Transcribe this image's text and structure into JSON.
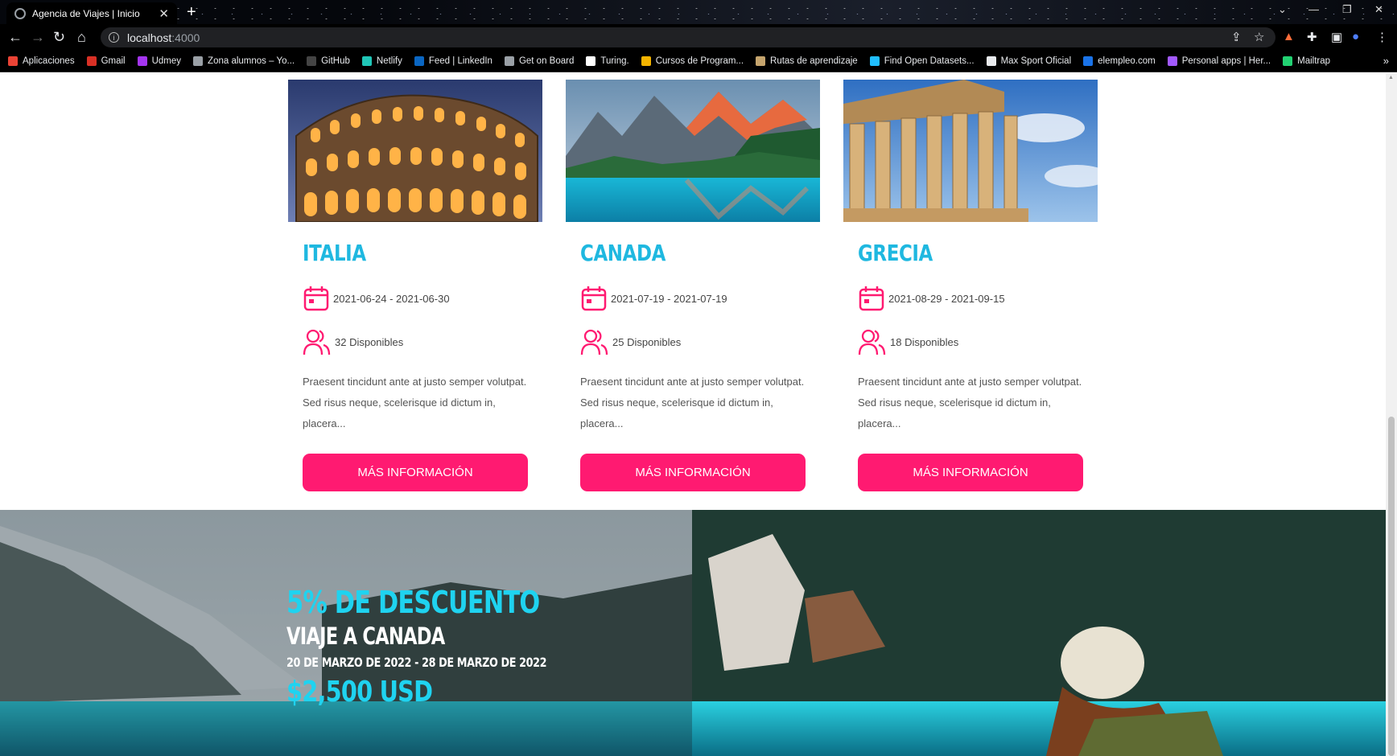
{
  "browser": {
    "tab_title": "Agencia de Viajes | Inicio",
    "url_host": "localhost",
    "url_port": ":4000",
    "bookmarks": [
      {
        "label": "Aplicaciones",
        "color": "#ea4335"
      },
      {
        "label": "Gmail",
        "color": "#d93025"
      },
      {
        "label": "Udmey",
        "color": "#a435f0"
      },
      {
        "label": "Zona alumnos – Yo...",
        "color": "#9aa0a6"
      },
      {
        "label": "GitHub",
        "color": "#444444"
      },
      {
        "label": "Netlify",
        "color": "#20c6b7"
      },
      {
        "label": "Feed | LinkedIn",
        "color": "#0a66c2"
      },
      {
        "label": "Get on Board",
        "color": "#9aa0a6"
      },
      {
        "label": "Turing.",
        "color": "#ffffff"
      },
      {
        "label": "Cursos de Program...",
        "color": "#f4b400"
      },
      {
        "label": "Rutas de aprendizaje",
        "color": "#c5a46d"
      },
      {
        "label": "Find Open Datasets...",
        "color": "#20beff"
      },
      {
        "label": "Max Sport Oficial",
        "color": "#e8eaed"
      },
      {
        "label": "elempleo.com",
        "color": "#1a73e8"
      },
      {
        "label": "Personal apps | Her...",
        "color": "#a259ff"
      },
      {
        "label": "Mailtrap",
        "color": "#22d172"
      }
    ]
  },
  "accent_color": "#ff1a71",
  "title_color": "#1fb8e0",
  "trips": [
    {
      "title": "ITALIA",
      "dates": "2021-06-24 - 2021-06-30",
      "available": "32 Disponibles",
      "description": "Praesent tincidunt ante at justo semper volutpat. Sed risus neque, scelerisque id dictum in, placera...",
      "button": "MÁS INFORMACIÓN",
      "image": "colosseum"
    },
    {
      "title": "CANADA",
      "dates": "2021-07-19 - 2021-07-19",
      "available": "25 Disponibles",
      "description": "Praesent tincidunt ante at justo semper volutpat. Sed risus neque, scelerisque id dictum in, placera...",
      "button": "MÁS INFORMACIÓN",
      "image": "mountain-lake"
    },
    {
      "title": "GRECIA",
      "dates": "2021-08-29 - 2021-09-15",
      "available": "18 Disponibles",
      "description": "Praesent tincidunt ante at justo semper volutpat. Sed risus neque, scelerisque id dictum in, placera...",
      "button": "MÁS INFORMACIÓN",
      "image": "parthenon"
    }
  ],
  "promo": {
    "discount": "5% DE DESCUENTO",
    "trip": "VIAJE A CANADA",
    "dates": "20 DE MARZO DE 2022 - 28 DE MARZO DE 2022",
    "price": "$2,500 USD"
  }
}
